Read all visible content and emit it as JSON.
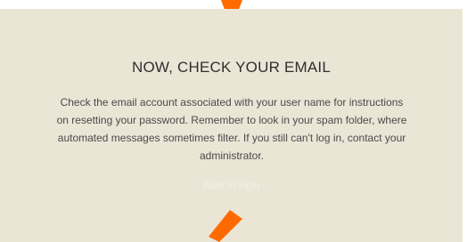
{
  "dialog": {
    "title": "NOW, CHECK YOUR EMAIL",
    "message": "Check the email account associated with your user name for instructions on resetting your password. Remember to look in your spam folder, where automated messages sometimes filter. If you still can't log in, contact your administrator.",
    "back_link": "Back to login"
  },
  "annotations": {
    "arrow_color": "#ff6a00",
    "arrows": [
      "arrow-pointing-down-icon",
      "arrow-pointing-up-icon"
    ]
  },
  "colors": {
    "panel_background": "#ebe5d6",
    "title_text": "#2f2f2f",
    "body_text": "#4a4a4a",
    "link_text": "#f4f0e7"
  }
}
